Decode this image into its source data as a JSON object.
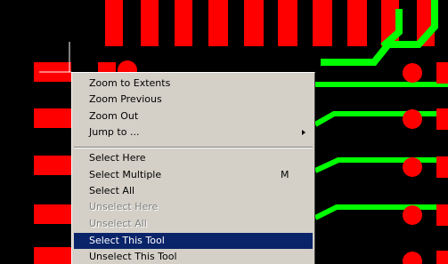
{
  "colors": {
    "canvas_background": "#000000",
    "pad": "#ff0000",
    "trace": "#00ff00",
    "menu_background": "#d4d0c8",
    "menu_highlight": "#0a246a",
    "menu_disabled_text": "#808080"
  },
  "context_menu": {
    "items": [
      {
        "label": "Zoom to Extents",
        "state": "enabled"
      },
      {
        "label": "Zoom Previous",
        "state": "enabled"
      },
      {
        "label": "Zoom Out",
        "state": "enabled"
      },
      {
        "label": "Jump to ...",
        "state": "enabled",
        "submenu": "chevron-right-icon"
      },
      {
        "label": "Select Here",
        "state": "enabled"
      },
      {
        "label": "Select Multiple",
        "state": "enabled",
        "shortcut": "M"
      },
      {
        "label": "Select All",
        "state": "enabled"
      },
      {
        "label": "Unselect Here",
        "state": "disabled"
      },
      {
        "label": "Unselect All",
        "state": "disabled"
      },
      {
        "label": "Select This Tool",
        "state": "highlighted"
      },
      {
        "label": "Unselect This Tool",
        "state": "enabled"
      }
    ]
  }
}
